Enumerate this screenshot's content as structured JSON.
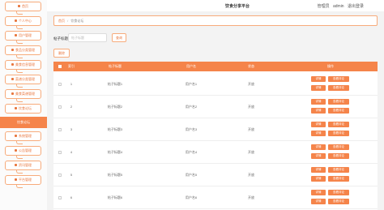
{
  "header": {
    "title": "饮食分享平台",
    "user_role": "管理员",
    "username": "admin",
    "logout": "退出登录"
  },
  "sidebar": {
    "items": [
      {
        "label": "首页",
        "icon": "home-icon"
      },
      {
        "label": "个人中心",
        "icon": "user-icon"
      },
      {
        "label": "用户管理",
        "icon": "users-icon"
      },
      {
        "label": "食品分类管理",
        "icon": "category-icon"
      },
      {
        "label": "美食信息管理",
        "icon": "food-icon"
      },
      {
        "label": "菜谱分类管理",
        "icon": "menu-icon"
      },
      {
        "label": "美食菜谱管理",
        "icon": "recipe-icon"
      },
      {
        "label": "饮食论坛",
        "icon": "forum-icon"
      },
      {
        "label": "饮食论坛",
        "icon": "forum-icon"
      },
      {
        "label": "系统管理",
        "icon": "settings-icon"
      },
      {
        "label": "公告管理",
        "icon": "notice-icon"
      },
      {
        "label": "资讯管理",
        "icon": "news-icon"
      },
      {
        "label": "平台管理",
        "icon": "platform-icon"
      }
    ]
  },
  "breadcrumb": {
    "home": "首页",
    "current": "饮食论坛"
  },
  "search": {
    "label": "帖子标题",
    "placeholder": "帖子标题",
    "button": "查询"
  },
  "actions": {
    "delete": "删除"
  },
  "table": {
    "columns": [
      "索引",
      "帖子标题",
      "用户名",
      "状态",
      "操作"
    ],
    "rows": [
      {
        "index": "1",
        "title": "帖子标题1",
        "username": "用户名1",
        "status": "开放",
        "edit": "详情",
        "more": "查看评论"
      },
      {
        "index": "2",
        "title": "帖子标题2",
        "username": "用户名2",
        "status": "开放",
        "edit": "详情",
        "more": "查看评论"
      },
      {
        "index": "3",
        "title": "帖子标题3",
        "username": "用户名3",
        "status": "开放",
        "edit": "详情",
        "more": "查看评论"
      },
      {
        "index": "4",
        "title": "帖子标题4",
        "username": "用户名4",
        "status": "开放",
        "edit": "详情",
        "more": "查看评论"
      },
      {
        "index": "5",
        "title": "帖子标题5",
        "username": "用户名5",
        "status": "开放",
        "edit": "详情",
        "more": "查看评论"
      },
      {
        "index": "6",
        "title": "帖子标题6",
        "username": "用户名6",
        "status": "开放",
        "edit": "详情",
        "more": "查看评论"
      }
    ]
  },
  "colors": {
    "accent": "#f5844a",
    "accent_text": "#e8773f",
    "border": "#f7ab7b"
  }
}
